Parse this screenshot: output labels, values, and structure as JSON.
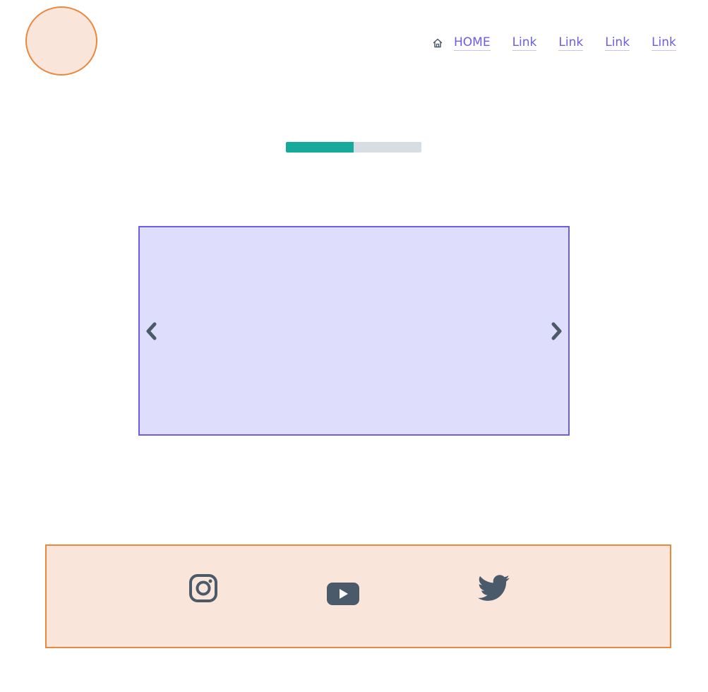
{
  "header": {
    "logo": "logo",
    "nav": {
      "home_label": "HOME",
      "links": [
        "Link",
        "Link",
        "Link",
        "Link"
      ]
    }
  },
  "progress": {
    "value": 0.5
  },
  "carousel": {
    "prev_icon": "chevron-left-icon",
    "next_icon": "chevron-right-icon"
  },
  "footer": {
    "social": [
      {
        "name": "instagram-icon"
      },
      {
        "name": "youtube-icon"
      },
      {
        "name": "twitter-icon"
      }
    ]
  },
  "colors": {
    "accent": "#6c5ce7",
    "brand_orange": "#e8893f",
    "panel_fill": "#fae5da",
    "carousel_fill": "#dedefc",
    "progress_fill": "#17a99b",
    "progress_track": "#d7dde2",
    "icon_color": "#4a5a6a"
  }
}
